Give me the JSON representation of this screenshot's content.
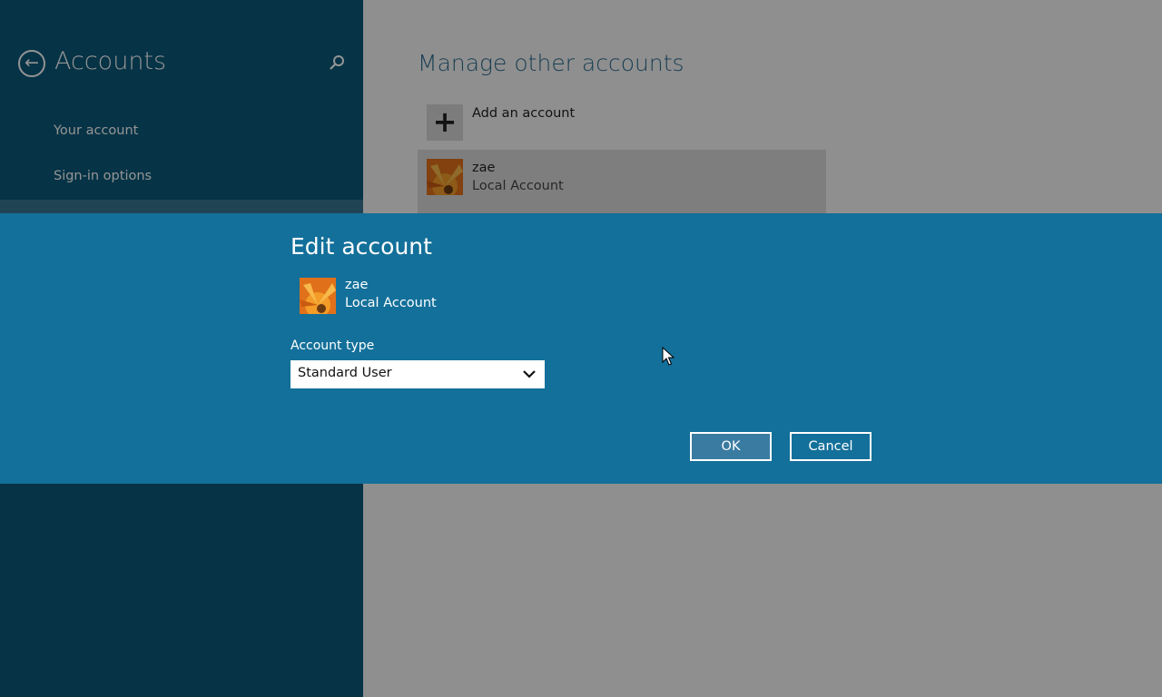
{
  "nav": {
    "title": "Accounts",
    "items": [
      {
        "label": "Your account"
      },
      {
        "label": "Sign-in options"
      }
    ]
  },
  "content": {
    "title": "Manage other accounts",
    "add_label": "Add an account",
    "account": {
      "name": "zae",
      "type": "Local Account"
    }
  },
  "dialog": {
    "title": "Edit account",
    "account_name": "zae",
    "account_type": "Local Account",
    "field_label": "Account type",
    "selected_value": "Standard User",
    "ok_label": "OK",
    "cancel_label": "Cancel"
  },
  "icons": {
    "back": "back-arrow-icon",
    "search": "search-icon",
    "add": "plus-icon",
    "avatar": "flower-avatar-icon",
    "chevron": "chevron-down-icon",
    "cursor": "mouse-cursor-icon"
  },
  "colors": {
    "nav_bg": "#0b5879",
    "dialog_bg": "#13709a",
    "title_accent": "#2f6d8f"
  }
}
